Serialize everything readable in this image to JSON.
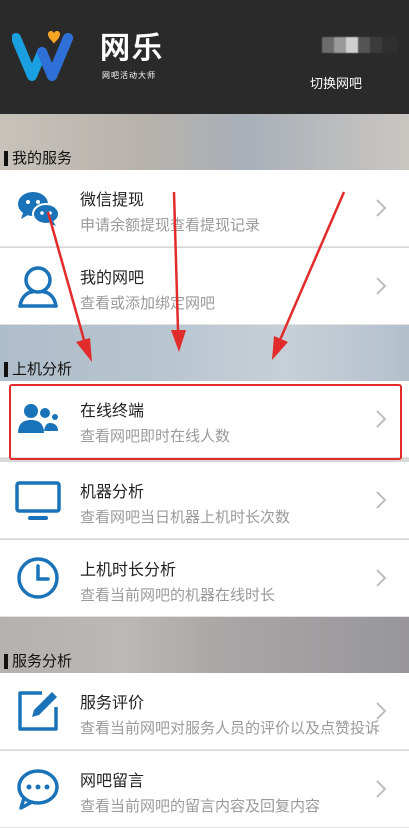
{
  "header": {
    "brand_title": "网乐",
    "brand_subtitle": "网吧活动大师",
    "switch_label": "切换网吧"
  },
  "sections": [
    {
      "label": "我的服务",
      "items": [
        {
          "title": "微信提现",
          "desc": "申请余额提现查看提现记录",
          "icon": "wechat-icon"
        },
        {
          "title": "我的网吧",
          "desc": "查看或添加绑定网吧",
          "icon": "user-icon"
        }
      ]
    },
    {
      "label": "上机分析",
      "items": [
        {
          "title": "在线终端",
          "desc": "查看网吧即时在线人数",
          "icon": "users-icon"
        },
        {
          "title": "机器分析",
          "desc": "查看网吧当日机器上机时长次数",
          "icon": "monitor-icon"
        },
        {
          "title": "上机时长分析",
          "desc": "查看当前网吧的机器在线时长",
          "icon": "clock-icon"
        }
      ]
    },
    {
      "label": "服务分析",
      "items": [
        {
          "title": "服务评价",
          "desc": "查看当前网吧对服务人员的评价以及点赞投诉",
          "icon": "edit-icon"
        },
        {
          "title": "网吧留言",
          "desc": "查看当前网吧的留言内容及回复内容",
          "icon": "message-icon"
        }
      ]
    }
  ],
  "colors": {
    "accent_blue": "#1a73b8",
    "highlight_red": "#e22b2b",
    "header_bg": "#2a2a2a"
  }
}
